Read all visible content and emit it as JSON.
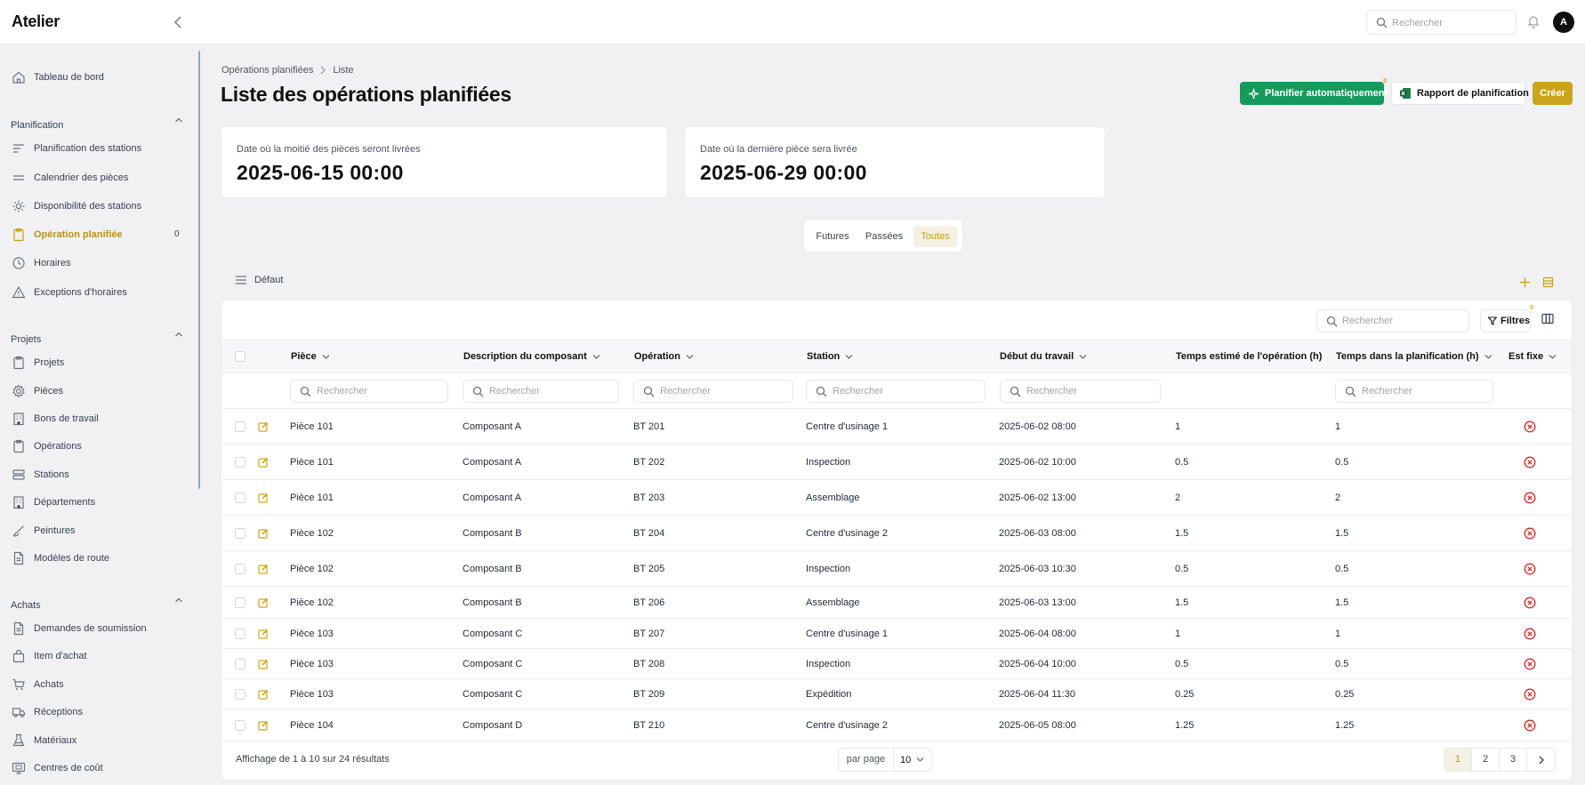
{
  "app": {
    "brand": "Atelier"
  },
  "topbar": {
    "search_placeholder": "Rechercher",
    "avatar_initial": "A"
  },
  "sidebar": {
    "top_items": [
      {
        "label": "Tableau de bord",
        "icon": "home-icon"
      }
    ],
    "sections": [
      {
        "title": "Planification",
        "items": [
          {
            "label": "Planification des stations",
            "icon": "align-left-icon"
          },
          {
            "label": "Calendrier des pièces",
            "icon": "lines-icon"
          },
          {
            "label": "Disponibilité des stations",
            "icon": "sun-icon"
          },
          {
            "label": "Opération planifiée",
            "icon": "clipboard-icon",
            "active": true,
            "badge": "0"
          },
          {
            "label": "Horaires",
            "icon": "clock-icon"
          },
          {
            "label": "Exceptions d'horaires",
            "icon": "warning-icon"
          }
        ]
      },
      {
        "title": "Projets",
        "items": [
          {
            "label": "Projets",
            "icon": "clipboard-icon"
          },
          {
            "label": "Pièces",
            "icon": "gear-icon"
          },
          {
            "label": "Bons de travail",
            "icon": "building-icon"
          },
          {
            "label": "Opérations",
            "icon": "clipboard-icon"
          },
          {
            "label": "Stations",
            "icon": "server-icon"
          },
          {
            "label": "Départements",
            "icon": "building-icon"
          },
          {
            "label": "Peintures",
            "icon": "brush-icon"
          },
          {
            "label": "Modèles de route",
            "icon": "file-icon"
          }
        ]
      },
      {
        "title": "Achats",
        "items": [
          {
            "label": "Demandes de soumission",
            "icon": "file-icon"
          },
          {
            "label": "Item d'achat",
            "icon": "bag-icon"
          },
          {
            "label": "Achats",
            "icon": "cart-icon"
          },
          {
            "label": "Réceptions",
            "icon": "truck-icon"
          },
          {
            "label": "Matériaux",
            "icon": "flask-icon"
          },
          {
            "label": "Centres de coût",
            "icon": "monitor-icon"
          }
        ]
      }
    ]
  },
  "breadcrumb": [
    "Opérations planifiées",
    "Liste"
  ],
  "page": {
    "title": "Liste des opérations planifiées"
  },
  "actions": {
    "auto_plan": "Planifier automatiquement",
    "auto_plan_badge": "0",
    "report": "Rapport de planification",
    "create": "Créer"
  },
  "stats": [
    {
      "label": "Date où la moitié des pièces seront livrées",
      "value": "2025-06-15 00:00"
    },
    {
      "label": "Date où la dernière pièce sera livrée",
      "value": "2025-06-29 00:00"
    }
  ],
  "segments": {
    "options": [
      "Futures",
      "Passées",
      "Toutes"
    ],
    "selected": "Toutes"
  },
  "view": {
    "label": "Défaut"
  },
  "table": {
    "search_placeholder": "Rechercher",
    "filters_label": "Filtres",
    "filters_badge": "0",
    "filter_placeholder": "Rechercher",
    "columns": [
      "Pièce",
      "Description du composant",
      "Opération",
      "Station",
      "Début du travail",
      "Temps estimé de l'opération (h)",
      "Temps dans la planification (h)",
      "Est fixe"
    ],
    "rows": [
      [
        "Pièce 101",
        "Composant A",
        "BT 201",
        "Centre d'usinage 1",
        "2025-06-02 08:00",
        "1",
        "1"
      ],
      [
        "Pièce 101",
        "Composant A",
        "BT 202",
        "Inspection",
        "2025-06-02 10:00",
        "0.5",
        "0.5"
      ],
      [
        "Pièce 101",
        "Composant A",
        "BT 203",
        "Assemblage",
        "2025-06-02 13:00",
        "2",
        "2"
      ],
      [
        "Pièce 102",
        "Composant B",
        "BT 204",
        "Centre d'usinage 2",
        "2025-06-03 08:00",
        "1.5",
        "1.5"
      ],
      [
        "Pièce 102",
        "Composant B",
        "BT 205",
        "Inspection",
        "2025-06-03 10:30",
        "0.5",
        "0.5"
      ],
      [
        "Pièce 102",
        "Composant B",
        "BT 206",
        "Assemblage",
        "2025-06-03 13:00",
        "1.5",
        "1.5"
      ],
      [
        "Pièce 103",
        "Composant C",
        "BT 207",
        "Centre d'usinage 1",
        "2025-06-04 08:00",
        "1",
        "1"
      ],
      [
        "Pièce 103",
        "Composant C",
        "BT 208",
        "Inspection",
        "2025-06-04 10:00",
        "0.5",
        "0.5"
      ],
      [
        "Pièce 103",
        "Composant C",
        "BT 209",
        "Expédition",
        "2025-06-04 11:30",
        "0.25",
        "0.25"
      ],
      [
        "Pièce 104",
        "Composant D",
        "BT 210",
        "Centre d'usinage 2",
        "2025-06-05 08:00",
        "1.25",
        "1.25"
      ]
    ]
  },
  "footer": {
    "summary": "Affichage de 1 à 10 sur 24 résultats",
    "per_page_label": "par page",
    "per_page_value": "10",
    "pages": [
      "1",
      "2",
      "3"
    ],
    "current_page": "1"
  },
  "colors": {
    "accent": "#caa51a",
    "green": "#159a5b",
    "danger": "#dc2626"
  }
}
